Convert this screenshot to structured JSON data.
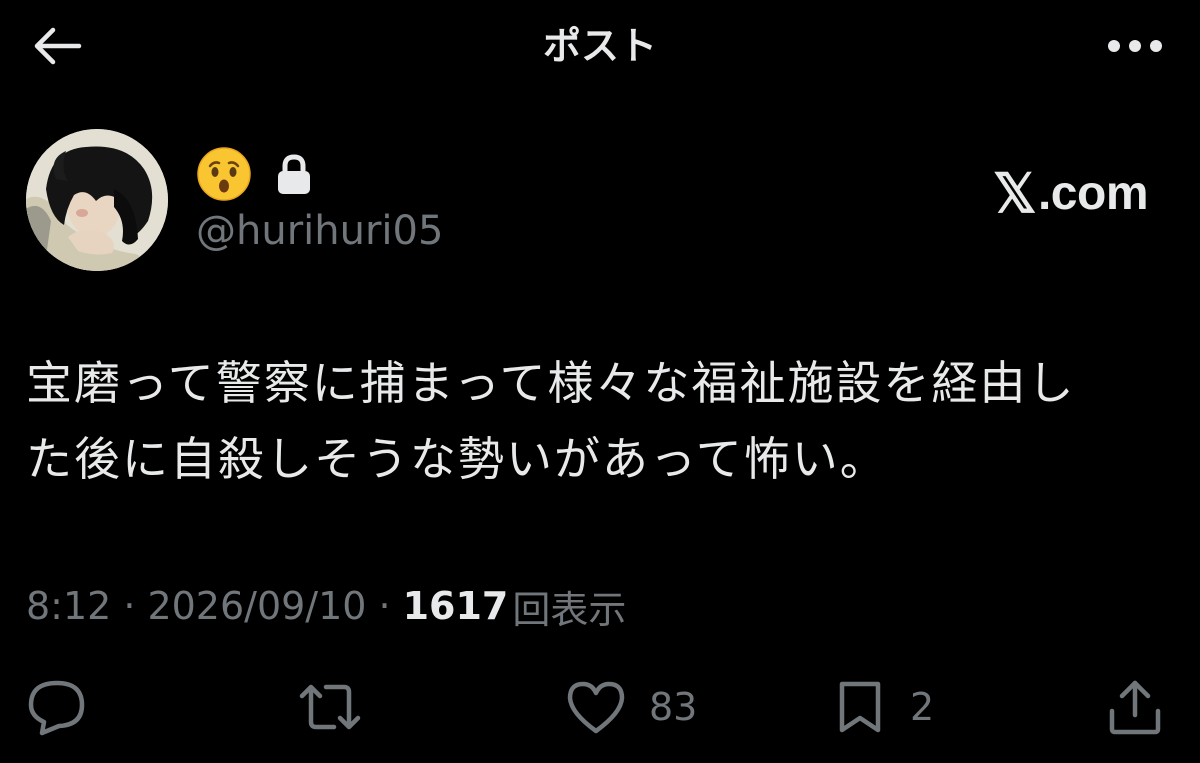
{
  "header": {
    "title": "ポスト",
    "back_icon": "back-arrow-icon",
    "more_icon": "more-horizontal-icon"
  },
  "author": {
    "display_name_icons": [
      "hushed-face-emoji-icon",
      "lock-icon"
    ],
    "handle": "@hurihuri05"
  },
  "watermark": {
    "x_glyph": "𝕏",
    "text": ".com"
  },
  "post": {
    "text_line1": "宝磨って警察に捕まって様々な福祉施設を経由し",
    "text_line2": "た後に自殺しそうな勢いがあって怖い。"
  },
  "meta": {
    "time": "8:12",
    "separator": "·",
    "date": "2026/09/10",
    "views_count": "1617",
    "views_label": "回表示"
  },
  "actions": {
    "reply_icon": "reply-icon",
    "repost_icon": "repost-icon",
    "like_icon": "like-heart-icon",
    "like_count": "83",
    "bookmark_icon": "bookmark-icon",
    "bookmark_count": "2",
    "share_icon": "share-icon"
  },
  "colors": {
    "background": "#000000",
    "primary_text": "#e7e9ea",
    "secondary_text": "#71767b"
  }
}
